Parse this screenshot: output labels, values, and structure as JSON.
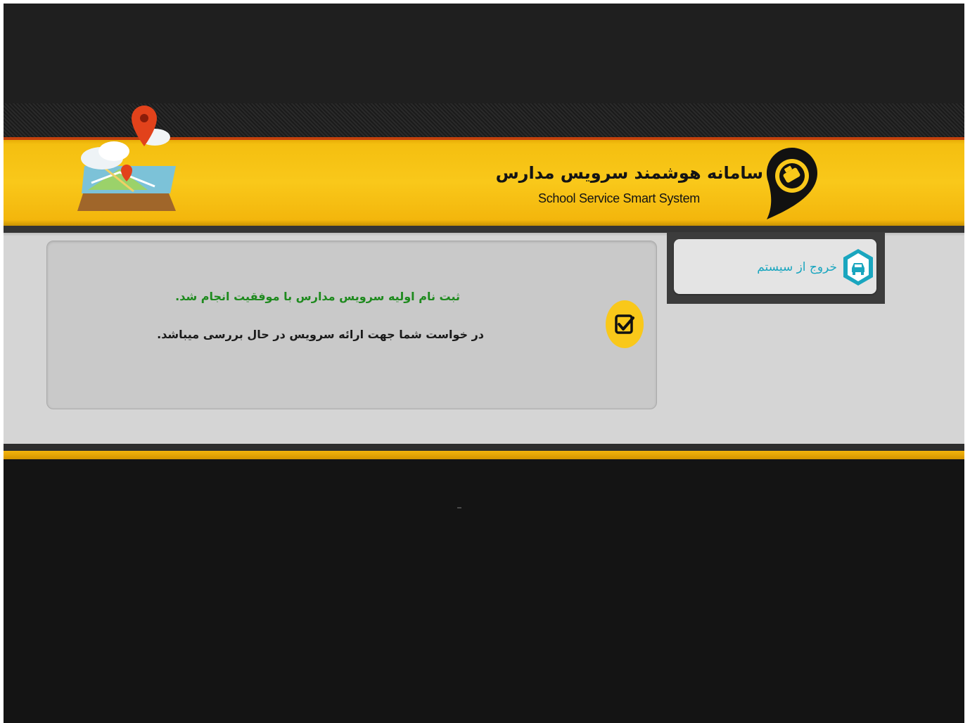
{
  "header": {
    "title": "سامانه هوشمند سرویس مدارس",
    "subtitle": "School Service Smart System",
    "logo_icon": "taxi-pin-icon",
    "map_icon": "map-pin-icon"
  },
  "sidebar": {
    "items": [
      {
        "label": "خروج از سیستم",
        "icon": "car-hexagon-icon"
      }
    ]
  },
  "message": {
    "success": "ثبت نام اولیه سرویس مدارس با موفقیت انجام شد.",
    "info": "در خواست شما جهت ارائه سرویس در حال بررسی میباشد.",
    "icon": "checkbox-icon"
  },
  "colors": {
    "accent": "#f9c81a",
    "success_text": "#1e8a1e",
    "link_text": "#1aa6bf",
    "dark": "#141414"
  }
}
